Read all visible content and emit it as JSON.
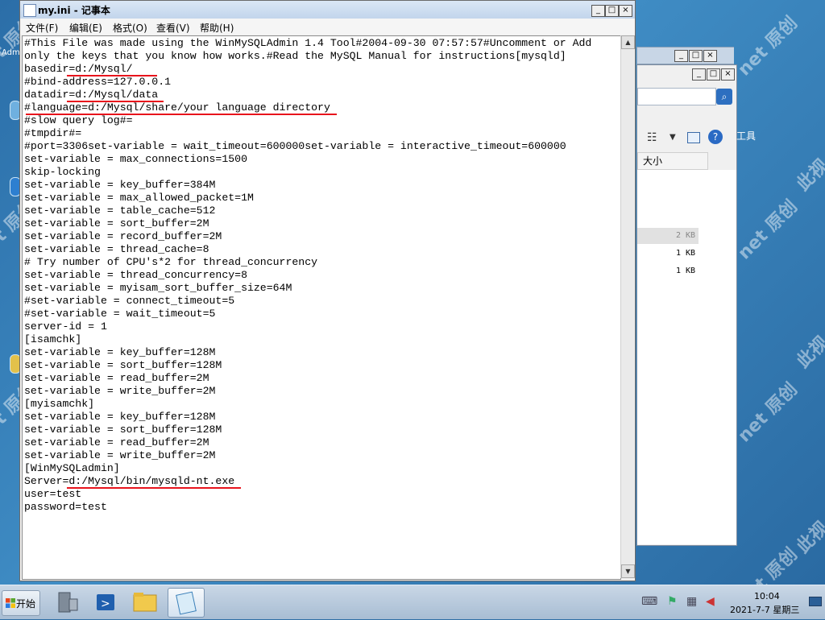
{
  "window": {
    "title": "my.ini - 记事本",
    "buttons": {
      "minimize": "_",
      "maximize": "□",
      "close": "×"
    }
  },
  "menu": [
    "文件(F)",
    "编辑(E)",
    "格式(O)",
    "查看(V)",
    "帮助(H)"
  ],
  "editor_lines": [
    "#This File was made using the WinMySQLAdmin 1.4 Tool#2004-09-30 07:57:57#Uncomment or Add",
    "only the keys that you know how works.#Read the MySQL Manual for instructions[mysqld]",
    "basedir=d:/Mysql/",
    "#bind-address=127.0.0.1",
    "datadir=d:/Mysql/data",
    "#language=d:/Mysql/share/your language directory",
    "#slow query log#=",
    "#tmpdir#=",
    "#port=3306set-variable = wait_timeout=600000set-variable = interactive_timeout=600000",
    "set-variable = max_connections=1500",
    "skip-locking",
    "set-variable = key_buffer=384M",
    "set-variable = max_allowed_packet=1M",
    "set-variable = table_cache=512",
    "set-variable = sort_buffer=2M",
    "set-variable = record_buffer=2M",
    "set-variable = thread_cache=8",
    "# Try number of CPU's*2 for thread_concurrency",
    "set-variable = thread_concurrency=8",
    "set-variable = myisam_sort_buffer_size=64M",
    "#set-variable = connect_timeout=5",
    "#set-variable = wait_timeout=5",
    "server-id = 1",
    "[isamchk]",
    "set-variable = key_buffer=128M",
    "set-variable = sort_buffer=128M",
    "set-variable = read_buffer=2M",
    "set-variable = write_buffer=2M",
    "[myisamchk]",
    "set-variable = key_buffer=128M",
    "set-variable = sort_buffer=128M",
    "set-variable = read_buffer=2M",
    "set-variable = write_buffer=2M",
    "[WinMySQLadmin]",
    "Server=d:/Mysql/bin/mysqld-nt.exe",
    "user=test",
    "password=test"
  ],
  "background_window": {
    "column_header": "大小",
    "sizes": [
      "2 KB",
      "1 KB",
      "1 KB"
    ],
    "side_label": "工具"
  },
  "taskbar": {
    "start_label": "开始",
    "time": "10:04",
    "date": "2021-7-7 星期三"
  },
  "watermark_text": "net 原创",
  "watermark_text2": "此视",
  "desktop_label": "Adm"
}
